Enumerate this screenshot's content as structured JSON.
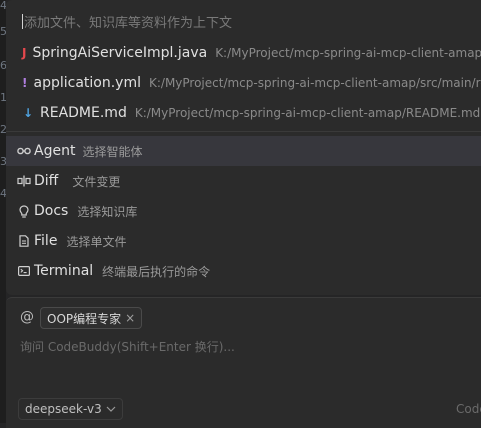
{
  "context_picker": {
    "placeholder": "添加文件、知识库等资料作为上下文",
    "files": [
      {
        "name": "SpringAiServiceImpl.java",
        "path": "K:/MyProject/mcp-spring-ai-mcp-client-amap/src/ma",
        "icon": "java-file-icon",
        "color": "#e5484d",
        "glyph": "J"
      },
      {
        "name": "application.yml",
        "path": "K:/MyProject/mcp-spring-ai-mcp-client-amap/src/main/resource",
        "icon": "yaml-file-icon",
        "color": "#b07fe0",
        "glyph": "!"
      },
      {
        "name": "README.md",
        "path": "K:/MyProject/mcp-spring-ai-mcp-client-amap/README.md",
        "icon": "markdown-file-icon",
        "color": "#4fa3e0",
        "glyph": "↓"
      }
    ],
    "commands": [
      {
        "label": "Agent",
        "desc": "选择智能体",
        "icon": "agent-icon",
        "active": true
      },
      {
        "label": "Diff",
        "desc": "文件变更",
        "icon": "diff-icon"
      },
      {
        "label": "Docs",
        "desc": "选择知识库",
        "icon": "docs-icon"
      },
      {
        "label": "File",
        "desc": "选择单文件",
        "icon": "file-icon"
      },
      {
        "label": "Terminal",
        "desc": "终端最后执行的命令",
        "icon": "terminal-icon"
      }
    ]
  },
  "chat": {
    "at_symbol": "@",
    "agent_chip": "OOP编程专家",
    "chip_close": "×",
    "placeholder": "询问 CodeBuddy(Shift+Enter 换行)...",
    "model": "deepseek-v3",
    "brand": "Code"
  },
  "editor_gutter": [
    "4",
    "5",
    "6",
    "1",
    "2",
    "3",
    "4"
  ]
}
